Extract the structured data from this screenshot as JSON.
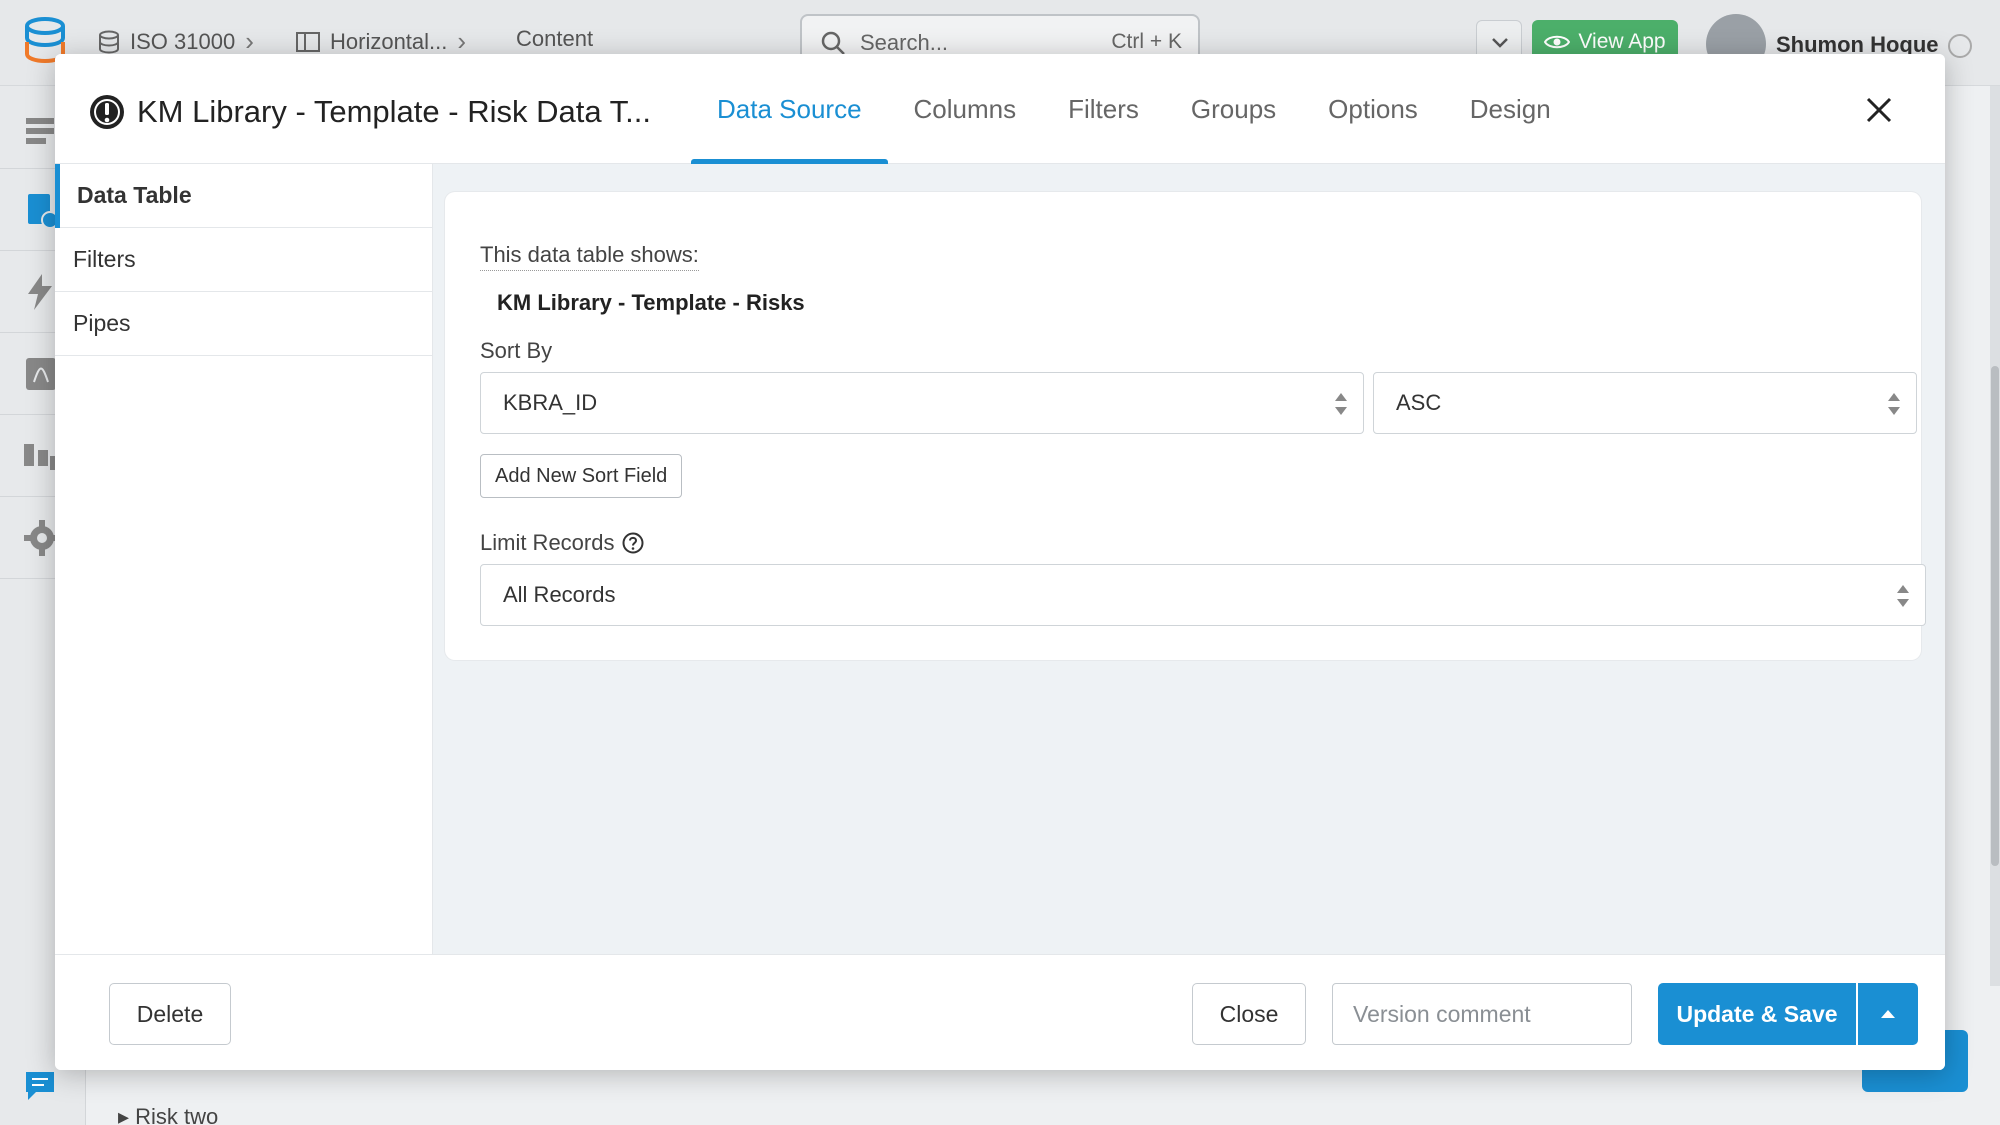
{
  "background": {
    "breadcrumb": [
      {
        "icon": "database-icon",
        "label": "ISO 31000"
      },
      {
        "icon": "layout-icon",
        "label": "Horizontal..."
      },
      {
        "icon": "",
        "label": "Content"
      }
    ],
    "search": {
      "placeholder": "Search...",
      "shortcut": "Ctrl + K"
    },
    "view_app_label": "View App",
    "user_name": "Shumon Hoque",
    "tree_item": "Risk two"
  },
  "modal": {
    "title": "KM Library - Template - Risk Data T...",
    "tabs": [
      {
        "label": "Data Source",
        "active": true
      },
      {
        "label": "Columns",
        "active": false
      },
      {
        "label": "Filters",
        "active": false
      },
      {
        "label": "Groups",
        "active": false
      },
      {
        "label": "Options",
        "active": false
      },
      {
        "label": "Design",
        "active": false
      }
    ],
    "sidebar": [
      {
        "label": "Data Table",
        "active": true
      },
      {
        "label": "Filters",
        "active": false
      },
      {
        "label": "Pipes",
        "active": false
      }
    ],
    "content": {
      "shows_label": "This data table shows:",
      "table_name": "KM Library - Template - Risks",
      "sort_label": "Sort By",
      "sort_field": "KBRA_ID",
      "sort_direction": "ASC",
      "add_sort_label": "Add New Sort Field",
      "limit_label": "Limit Records",
      "limit_value": "All Records"
    },
    "footer": {
      "delete_label": "Delete",
      "close_label": "Close",
      "version_placeholder": "Version comment",
      "save_label": "Update & Save"
    }
  },
  "colors": {
    "accent": "#1a8fd3",
    "view_app": "#4caf6a"
  }
}
